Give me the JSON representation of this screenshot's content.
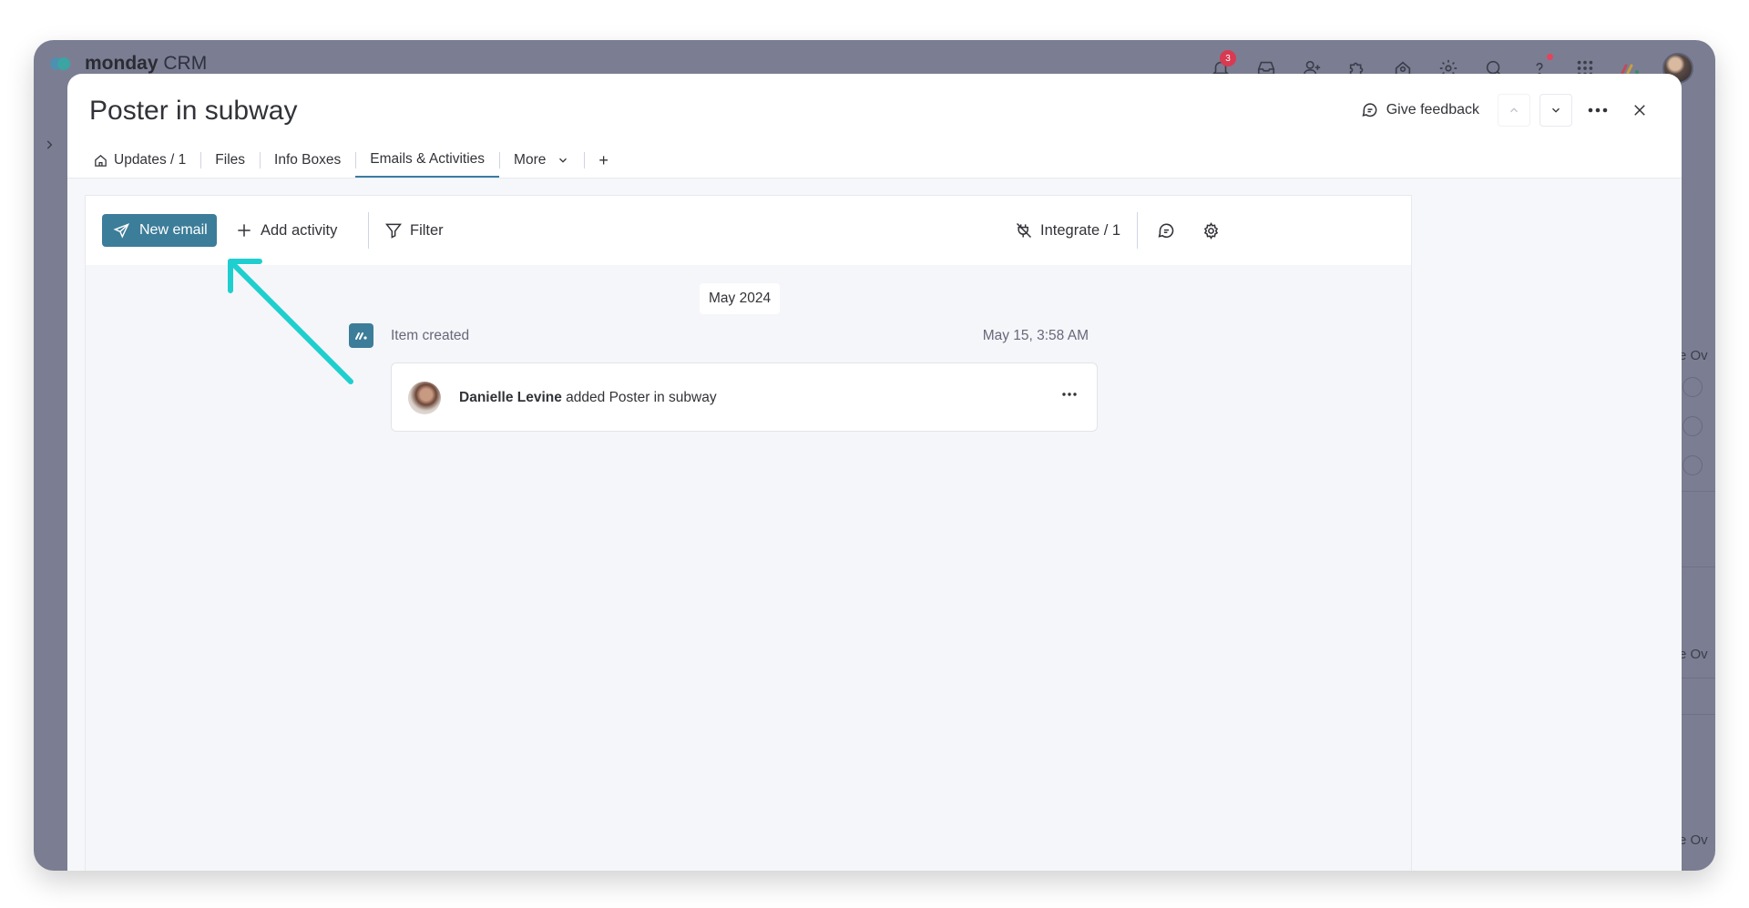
{
  "app": {
    "logo_text": "monday",
    "logo_sub": "CRM",
    "notification_count": "3"
  },
  "background": {
    "right_texts": [
      "e Ov",
      "e Ov",
      "e Ov"
    ]
  },
  "panel": {
    "title": "Poster in subway",
    "feedback_label": "Give feedback",
    "tabs": [
      {
        "label": "Updates / 1",
        "icon": "home-icon"
      },
      {
        "label": "Files"
      },
      {
        "label": "Info Boxes"
      },
      {
        "label": "Emails & Activities",
        "active": true
      },
      {
        "label": "More",
        "icon": "chevron-down-icon"
      },
      {
        "label": "+"
      }
    ]
  },
  "toolbar": {
    "new_email": "New email",
    "add_activity": "Add activity",
    "filter": "Filter",
    "integrate": "Integrate / 1"
  },
  "timeline": {
    "month": "May 2024",
    "activity": {
      "label": "Item created",
      "time": "May 15, 3:58 AM",
      "user": "Danielle Levine",
      "text": "added Poster in subway"
    }
  },
  "colors": {
    "accent": "#3c7d99",
    "annotation_arrow": "#1fcfcf",
    "backdrop": "#7b7e92"
  }
}
